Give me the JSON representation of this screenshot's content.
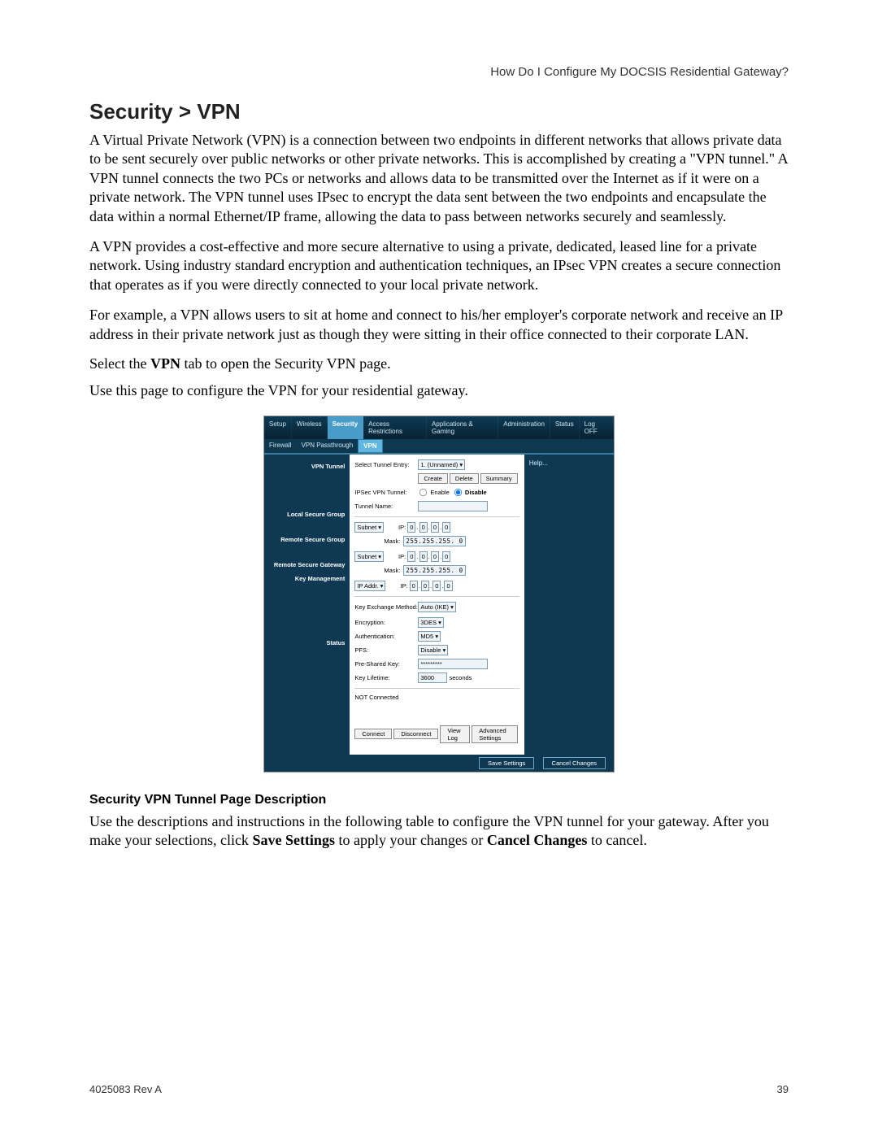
{
  "header": {
    "right": "How Do I Configure My DOCSIS Residential Gateway?"
  },
  "title": "Security > VPN",
  "paragraphs": {
    "p1": "A Virtual Private Network (VPN) is a connection between two endpoints in different networks that allows private data to be sent securely over public networks or other private networks. This is accomplished by creating a \"VPN tunnel.\" A VPN tunnel connects the two PCs or networks and allows data to be transmitted over the Internet as if it were on a private network. The VPN tunnel uses IPsec to encrypt the data sent between the two endpoints and encapsulate the data within a normal Ethernet/IP frame, allowing the data to pass between networks securely and seamlessly.",
    "p2": "A VPN provides a cost-effective and more secure alternative to using a private, dedicated, leased line for a private network. Using industry standard encryption and authentication techniques, an IPsec VPN creates a secure connection that operates as if you were directly connected to your local private network.",
    "p3": "For example, a VPN allows users to sit at home and connect to his/her employer's corporate network and receive an IP address in their private network just as though they were sitting in their office connected to their corporate LAN.",
    "p4a": "Select the ",
    "p4b": "VPN",
    "p4c": " tab to open the Security VPN page.",
    "p5": "Use this page to configure the VPN for your residential gateway."
  },
  "screenshot": {
    "mainTabs": [
      "Setup",
      "Wireless",
      "Security",
      "Access Restrictions",
      "Applications & Gaming",
      "Administration",
      "Status",
      "Log OFF"
    ],
    "mainActive": "Security",
    "subTabs": [
      "Firewall",
      "VPN Passthrough",
      "VPN"
    ],
    "subActive": "VPN",
    "helpLabel": "Help...",
    "leftLabels": {
      "vpnTunnel": "VPN Tunnel",
      "localSecureGroup": "Local Secure Group",
      "remoteSecureGroup": "Remote Secure Group",
      "remoteSecureGateway": "Remote Secure Gateway",
      "keyManagement": "Key Management",
      "status": "Status"
    },
    "fields": {
      "selectTunnelEntryLabel": "Select Tunnel Entry:",
      "selectTunnelEntryValue": "1. (Unnamed)",
      "createBtn": "Create",
      "deleteBtn": "Delete",
      "summaryBtn": "Summary",
      "ipsecLabel": "IPSec VPN Tunnel:",
      "enableLabel": "Enable",
      "disableLabel": "Disable",
      "tunnelNameLabel": "Tunnel Name:",
      "tunnelNameValue": "",
      "subnetOption": "Subnet",
      "ipAddrOption": "IP Addr.",
      "ipLabel": "IP:",
      "maskLabel": "Mask:",
      "ipZero": "0",
      "mask255": "255.255.255. 0",
      "keyExchangeLabel": "Key Exchange Method:",
      "keyExchangeValue": "Auto (IKE)",
      "encryptionLabel": "Encryption:",
      "encryptionValue": "3DES",
      "authLabel": "Authentication:",
      "authValue": "MD5",
      "pfsLabel": "PFS:",
      "pfsValue": "Disable",
      "pskLabel": "Pre-Shared Key:",
      "pskValue": "*********",
      "keyLifetimeLabel": "Key Lifetime:",
      "keyLifetimeValue": "3600",
      "secondsLabel": "seconds",
      "statusValue": "NOT Connected",
      "connectBtn": "Connect",
      "disconnectBtn": "Disconnect",
      "viewLogBtn": "View Log",
      "advSettingsBtn": "Advanced Settings"
    },
    "bottomBar": {
      "saveBtn": "Save Settings",
      "cancelBtn": "Cancel Changes"
    }
  },
  "subhead": "Security VPN Tunnel Page Description",
  "desc": {
    "a": "Use the descriptions and instructions in the following table to configure the VPN tunnel for your gateway. After you make your selections, click ",
    "b": "Save Settings",
    "c": " to apply your changes or ",
    "d": "Cancel Changes",
    "e": " to cancel."
  },
  "footer": {
    "left": "4025083 Rev A",
    "pagenum": "39"
  }
}
